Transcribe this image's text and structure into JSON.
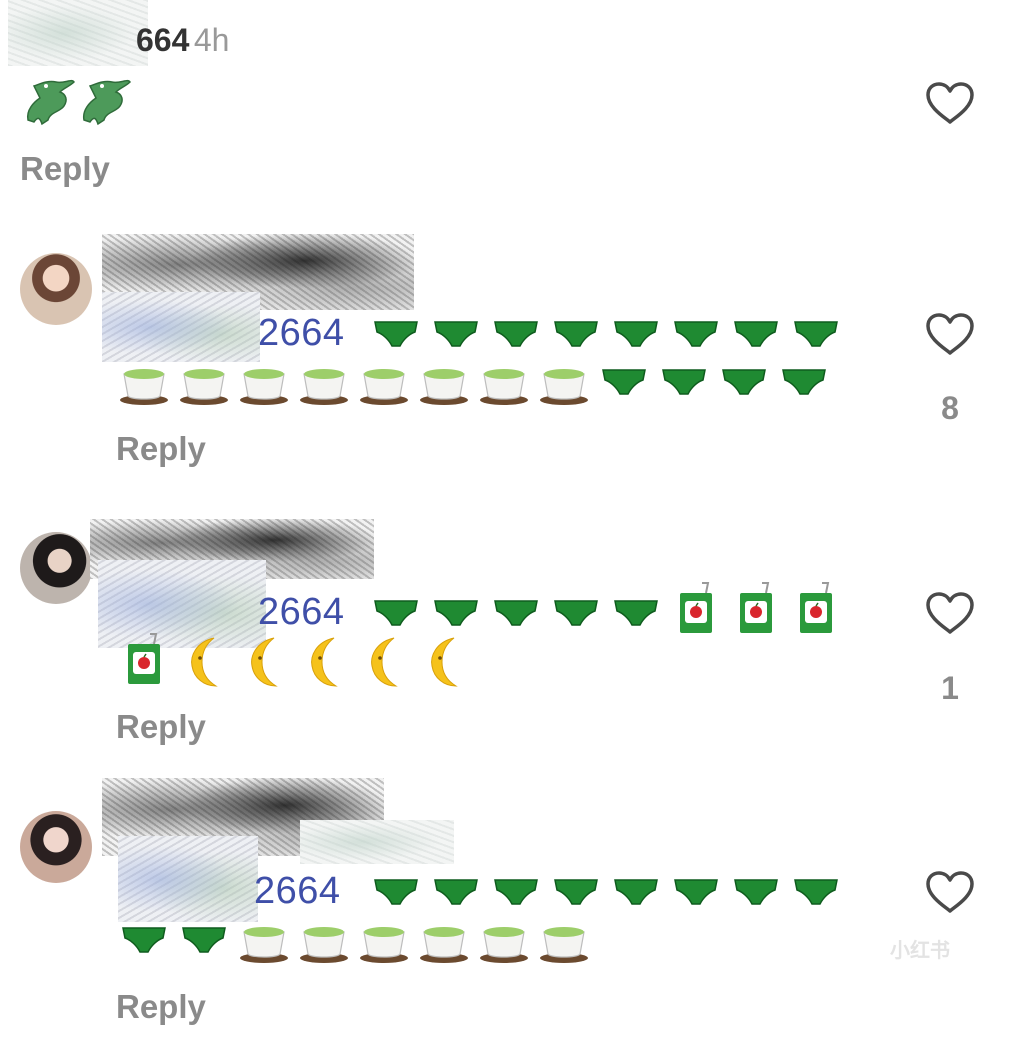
{
  "comments": [
    {
      "username_suffix": "664",
      "time": "4h",
      "reply_label": "Reply",
      "like_count": null
    },
    {
      "mention": "2664",
      "reply_label": "Reply",
      "like_count": "8"
    },
    {
      "mention": "2664",
      "reply_label": "Reply",
      "like_count": "1"
    },
    {
      "mention": "2664",
      "reply_label": "Reply",
      "like_count": null
    }
  ],
  "watermark": "小红书",
  "icons": {
    "like": "heart-outline-icon",
    "emojis": [
      "crocodile",
      "green-briefs",
      "green-tea-cup",
      "apple-juice-box",
      "crescent-moon-face"
    ]
  },
  "colors": {
    "mention": "#3f4fa8",
    "reply": "#8a8a8a",
    "time": "#999999",
    "heart_stroke": "#4a4a4a"
  }
}
